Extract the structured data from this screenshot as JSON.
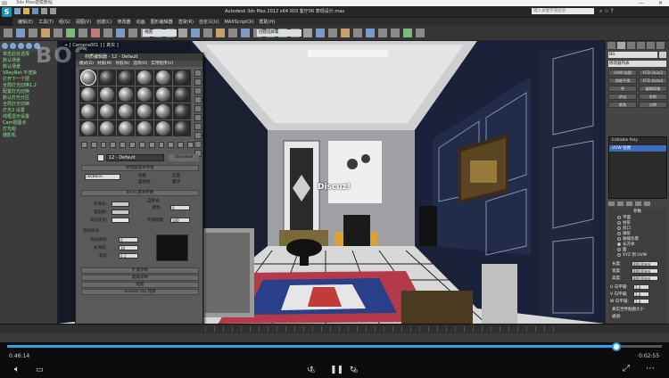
{
  "browser": {
    "title": "3ds Max建模教程",
    "minimize": "—",
    "close": "✕"
  },
  "app": {
    "title": "Autodesk 3ds Max  2012 x64      003 客厅06 表现设计.max",
    "search_placeholder": "键入关键字或短语"
  },
  "menu": [
    "编辑(E)",
    "工具(T)",
    "组(G)",
    "视图(V)",
    "创建(C)",
    "修改器",
    "动画",
    "图形编辑器",
    "渲染(R)",
    "自定义(U)",
    "MAXScript(X)",
    "帮助(H)"
  ],
  "toolbar": {
    "view_dropdown": "视图",
    "selection_set": "创建选择集"
  },
  "watermark": "BOS",
  "scene_explorer": {
    "items": [
      "单击此处选择",
      "默认场景",
      "默认场景",
      "VRayNet 不渲染",
      "打开下一个层",
      "全局灯光切换1,2",
      "配置灯光切换",
      "默认灯光分区",
      "全局灯光切换",
      "灯光3 设置",
      "线框显示设置",
      "Cam视图点",
      "灯光组",
      "摄影机"
    ]
  },
  "viewport": {
    "label": "+ [ Camera001 ] [ 真实 ]",
    "overlay_text": "Discuz!"
  },
  "material_editor": {
    "title": "材质编辑器 - 12 - Default",
    "menu": [
      "模式(D)",
      "材质(M)",
      "导航(N)",
      "选项(O)",
      "实用程序(U)"
    ],
    "material_name": "12 - Default",
    "material_type": "Standard",
    "rollouts": {
      "shader_basic": "明暗器基本参数",
      "blinn_basic": "Blinn 基本参数",
      "extended": "扩展参数",
      "supersampling": "超级采样",
      "maps": "贴图",
      "mental_ray": "mental ray 连接"
    },
    "shader": "(B)Blinn",
    "shader_options": [
      "线框",
      "双面",
      "面贴图",
      "面状"
    ],
    "ambient_label": "环境光:",
    "diffuse_label": "漫反射:",
    "specular_label": "高光反射:",
    "self_illum_label": "自发光",
    "color_label": "颜色",
    "color_value": "0",
    "opacity_label": "不透明度:",
    "opacity_value": "100",
    "spec_highlights": "反射高光",
    "spec_level_label": "高光级别:",
    "spec_level_value": "0",
    "gloss_label": "光泽度:",
    "gloss_value": "10",
    "soften_label": "柔化:",
    "soften_value": "0.1"
  },
  "command_panel": {
    "object_name": "BG",
    "modifier_list": "修改器列表",
    "buttons": [
      "UVW 贴图",
      "FFD 2x2x2",
      "网格平滑",
      "FFD 4x4x4",
      "壳",
      "编辑网格",
      "挤出",
      "车削",
      "倒角",
      "对称"
    ],
    "stack_items": [
      "UVW 贴图",
      "Editable Poly"
    ],
    "params_title": "参数",
    "mapping": [
      "平面",
      "柱形",
      "封口",
      "球形",
      "收缩包裹",
      "长方体",
      "面",
      "XYZ 到 UVW"
    ],
    "length_label": "长度:",
    "length_value": "800.0mm",
    "width_label": "宽度:",
    "width_value": "800.0mm",
    "height_label": "高度:",
    "height_value": "800.0mm",
    "u_tile": "U 向平铺:",
    "v_tile": "V 向平铺:",
    "w_tile": "W 向平铺:",
    "tile_value": "1.0",
    "real_world": "真实世界贴图大小",
    "channel": "通道:",
    "channel_map": "贴图通道:",
    "vertex_color": "顶点颜色通道",
    "align": "对齐:"
  },
  "player": {
    "current_time": "0:46:14",
    "total_time": "0:02:55",
    "progress": 0.93,
    "back_label": "15",
    "fwd_label": "30"
  },
  "colors": {
    "accent": "#27a6f0",
    "scene_text": "#8fe38f",
    "stack_selected": "#3d6cc0"
  }
}
